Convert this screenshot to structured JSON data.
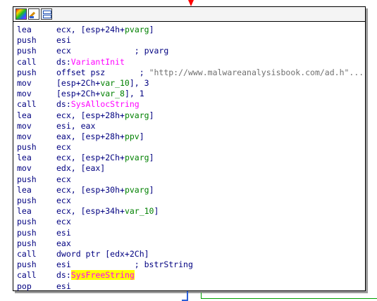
{
  "toolbar": {
    "icons": [
      "color-palette-icon",
      "edit-pen-icon",
      "graph-overview-icon"
    ]
  },
  "lines": [
    {
      "mnem": "lea",
      "parts": [
        {
          "t": "ecx, [esp+"
        },
        {
          "t": "24h",
          "c": "plain"
        },
        {
          "t": "+"
        },
        {
          "t": "pvarg",
          "c": "var"
        },
        {
          "t": "]"
        }
      ]
    },
    {
      "mnem": "push",
      "parts": [
        {
          "t": "esi"
        }
      ]
    },
    {
      "mnem": "push",
      "parts": [
        {
          "t": "ecx"
        },
        {
          "t": "             ; pvarg",
          "c": "cmt"
        }
      ]
    },
    {
      "mnem": "call",
      "parts": [
        {
          "t": "ds:"
        },
        {
          "t": "VariantInit",
          "c": "api"
        }
      ]
    },
    {
      "mnem": "push",
      "parts": [
        {
          "t": "offset psz"
        },
        {
          "t": "       ; ",
          "c": "cmt"
        },
        {
          "t": "\"http://www.malwareanalysisbook.com/ad.h\"...",
          "c": "str"
        }
      ]
    },
    {
      "mnem": "mov",
      "parts": [
        {
          "t": "[esp+2Ch+"
        },
        {
          "t": "var_10",
          "c": "var"
        },
        {
          "t": "], 3"
        }
      ]
    },
    {
      "mnem": "mov",
      "parts": [
        {
          "t": "[esp+2Ch+"
        },
        {
          "t": "var_8",
          "c": "var"
        },
        {
          "t": "], 1"
        }
      ]
    },
    {
      "mnem": "call",
      "parts": [
        {
          "t": "ds:"
        },
        {
          "t": "SysAllocString",
          "c": "api"
        }
      ]
    },
    {
      "mnem": "lea",
      "parts": [
        {
          "t": "ecx, [esp+28h+"
        },
        {
          "t": "pvarg",
          "c": "var"
        },
        {
          "t": "]"
        }
      ]
    },
    {
      "mnem": "mov",
      "parts": [
        {
          "t": "esi, eax"
        }
      ]
    },
    {
      "mnem": "mov",
      "parts": [
        {
          "t": "eax, [esp+28h+"
        },
        {
          "t": "ppv",
          "c": "var"
        },
        {
          "t": "]"
        }
      ]
    },
    {
      "mnem": "push",
      "parts": [
        {
          "t": "ecx"
        }
      ]
    },
    {
      "mnem": "lea",
      "parts": [
        {
          "t": "ecx, [esp+2Ch+"
        },
        {
          "t": "pvarg",
          "c": "var"
        },
        {
          "t": "]"
        }
      ]
    },
    {
      "mnem": "mov",
      "parts": [
        {
          "t": "edx, [eax]"
        }
      ]
    },
    {
      "mnem": "push",
      "parts": [
        {
          "t": "ecx"
        }
      ]
    },
    {
      "mnem": "lea",
      "parts": [
        {
          "t": "ecx, [esp+30h+"
        },
        {
          "t": "pvarg",
          "c": "var"
        },
        {
          "t": "]"
        }
      ]
    },
    {
      "mnem": "push",
      "parts": [
        {
          "t": "ecx"
        }
      ]
    },
    {
      "mnem": "lea",
      "parts": [
        {
          "t": "ecx, [esp+34h+"
        },
        {
          "t": "var_10",
          "c": "var"
        },
        {
          "t": "]"
        }
      ]
    },
    {
      "mnem": "push",
      "parts": [
        {
          "t": "ecx"
        }
      ]
    },
    {
      "mnem": "push",
      "parts": [
        {
          "t": "esi"
        }
      ]
    },
    {
      "mnem": "push",
      "parts": [
        {
          "t": "eax"
        }
      ]
    },
    {
      "mnem": "call",
      "parts": [
        {
          "t": "dword ptr [edx+2Ch]"
        }
      ]
    },
    {
      "mnem": "push",
      "parts": [
        {
          "t": "esi"
        },
        {
          "t": "             ; bstrString",
          "c": "cmt"
        }
      ]
    },
    {
      "mnem": "call",
      "parts": [
        {
          "t": "ds:"
        },
        {
          "t": "SysFreeString",
          "c": "api-hl"
        }
      ]
    },
    {
      "mnem": "pop",
      "parts": [
        {
          "t": "esi"
        }
      ]
    }
  ],
  "colors": {
    "mnemonic": "#000080",
    "variable": "#008000",
    "api": "#ff00ff",
    "highlight": "#ffff00",
    "comment": "#000080",
    "string": "#707070",
    "edge_in": "#ff0000",
    "edge_true": "#2b5fd9",
    "edge_false": "#00a000"
  }
}
